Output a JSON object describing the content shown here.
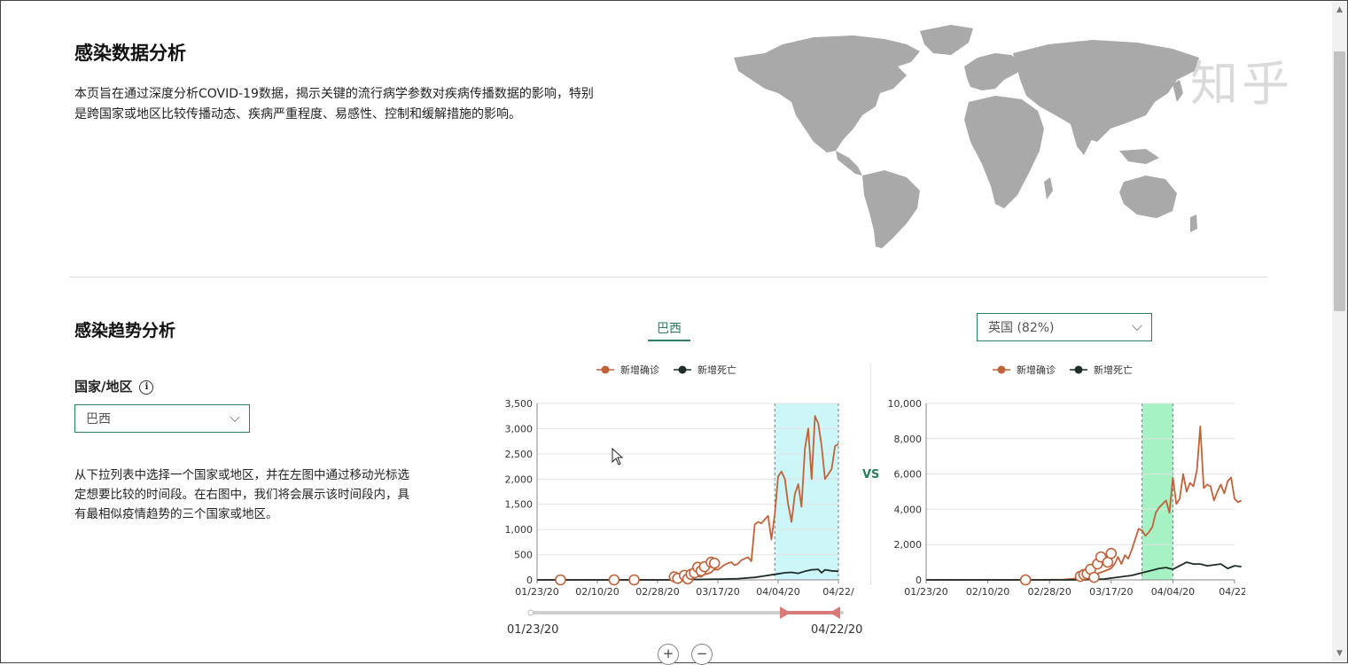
{
  "section1": {
    "title": "感染数据分析",
    "description_line1": "本页旨在通过深度分析COVID-19数据，揭示关键的流行病学参数对疾病传播数据的影响，特别",
    "description_line2": "是跨国家或地区比较传播动态、疾病严重程度、易感性、控制和缓解措施的影响。"
  },
  "watermark": "知乎",
  "section2": {
    "title": "感染趋势分析",
    "country_label": "国家/地区",
    "info_icon_glyph": "i",
    "country_select_value": "巴西",
    "help_line1": "从下拉列表中选择一个国家或地区，并在左图中通过移动光标选",
    "help_line2": "定想要比较的时间段。在右图中，我们将会展示该时间段内，具",
    "help_line3": "有最相似疫情趋势的三个国家或地区。"
  },
  "left_tab": "巴西",
  "right_select_value": "英国 (82%)",
  "vs_label": "VS",
  "legend": {
    "confirmed": "新增确诊",
    "deaths": "新增死亡"
  },
  "slider": {
    "start_label": "01/23/20",
    "end_label": "04/22/20"
  },
  "zoom": {
    "in": "+",
    "out": "−"
  },
  "colors": {
    "confirmed": "#c0623a",
    "deaths": "#1f2d2a",
    "accent": "#2e7d62",
    "highlight_left": "#cdf6f8",
    "highlight_right": "#a6f2c4",
    "slider_range": "#d97b78"
  },
  "chart_data": [
    {
      "type": "line",
      "country": "巴西",
      "x_ticks": [
        "01/23/20",
        "02/10/20",
        "02/28/20",
        "03/17/20",
        "04/04/20",
        "04/22/"
      ],
      "y_ticks": [
        "0",
        "500",
        "1,000",
        "1,500",
        "2,000",
        "2,500",
        "3,000",
        "3,500"
      ],
      "ylim": [
        0,
        3500
      ],
      "xlim_days": [
        0,
        90
      ],
      "highlight_days": [
        71,
        90
      ],
      "series": [
        {
          "name": "新增确诊",
          "points": [
            [
              0,
              0
            ],
            [
              10,
              0
            ],
            [
              20,
              0
            ],
            [
              30,
              0
            ],
            [
              38,
              0
            ],
            [
              40,
              0
            ],
            [
              43,
              10
            ],
            [
              45,
              40
            ],
            [
              47,
              90
            ],
            [
              49,
              60
            ],
            [
              50,
              110
            ],
            [
              51,
              120
            ],
            [
              52,
              150
            ],
            [
              53,
              210
            ],
            [
              54,
              200
            ],
            [
              55,
              250
            ],
            [
              56,
              300
            ],
            [
              57,
              330
            ],
            [
              58,
              350
            ],
            [
              59,
              290
            ],
            [
              60,
              320
            ],
            [
              61,
              390
            ],
            [
              62,
              420
            ],
            [
              63,
              450
            ],
            [
              64,
              370
            ],
            [
              65,
              1100
            ],
            [
              66,
              1150
            ],
            [
              67,
              1120
            ],
            [
              68,
              1200
            ],
            [
              69,
              1270
            ],
            [
              70,
              800
            ],
            [
              71,
              1300
            ],
            [
              72,
              2050
            ],
            [
              73,
              2150
            ],
            [
              74,
              2000
            ],
            [
              75,
              1500
            ],
            [
              76,
              1150
            ],
            [
              77,
              1700
            ],
            [
              78,
              1900
            ],
            [
              79,
              1450
            ],
            [
              80,
              2600
            ],
            [
              81,
              3000
            ],
            [
              82,
              2000
            ],
            [
              83,
              3250
            ],
            [
              84,
              3100
            ],
            [
              85,
              2650
            ],
            [
              86,
              2000
            ],
            [
              87,
              2100
            ],
            [
              88,
              2200
            ],
            [
              89,
              2650
            ],
            [
              90,
              2700
            ]
          ],
          "markers": [
            [
              7,
              0
            ],
            [
              23,
              0
            ],
            [
              29,
              0
            ],
            [
              41,
              60
            ],
            [
              42,
              30
            ],
            [
              44,
              90
            ],
            [
              45,
              20
            ],
            [
              46,
              110
            ],
            [
              47,
              140
            ],
            [
              48,
              250
            ],
            [
              49,
              180
            ],
            [
              50,
              260
            ],
            [
              52,
              350
            ],
            [
              53,
              330
            ]
          ]
        },
        {
          "name": "新增死亡",
          "points": [
            [
              0,
              0
            ],
            [
              40,
              0
            ],
            [
              50,
              10
            ],
            [
              55,
              15
            ],
            [
              60,
              25
            ],
            [
              65,
              50
            ],
            [
              68,
              80
            ],
            [
              70,
              100
            ],
            [
              72,
              120
            ],
            [
              74,
              140
            ],
            [
              76,
              150
            ],
            [
              78,
              130
            ],
            [
              80,
              170
            ],
            [
              82,
              200
            ],
            [
              84,
              210
            ],
            [
              85,
              140
            ],
            [
              86,
              200
            ],
            [
              88,
              180
            ],
            [
              90,
              170
            ]
          ]
        }
      ]
    },
    {
      "type": "line",
      "country": "英国 (82%)",
      "x_ticks": [
        "01/23/20",
        "02/10/20",
        "02/28/20",
        "03/17/20",
        "04/04/20",
        "04/22/"
      ],
      "y_ticks": [
        "0",
        "2,000",
        "4,000",
        "6,000",
        "8,000",
        "10,000"
      ],
      "ylim": [
        0,
        10000
      ],
      "xlim_days": [
        0,
        90
      ],
      "highlight_days": [
        63,
        72
      ],
      "series": [
        {
          "name": "新增确诊",
          "points": [
            [
              0,
              0
            ],
            [
              30,
              0
            ],
            [
              40,
              20
            ],
            [
              45,
              100
            ],
            [
              48,
              200
            ],
            [
              50,
              350
            ],
            [
              52,
              500
            ],
            [
              54,
              650
            ],
            [
              55,
              900
            ],
            [
              56,
              1300
            ],
            [
              57,
              900
            ],
            [
              58,
              1400
            ],
            [
              59,
              1200
            ],
            [
              60,
              1700
            ],
            [
              61,
              2300
            ],
            [
              62,
              2900
            ],
            [
              63,
              2800
            ],
            [
              64,
              2500
            ],
            [
              65,
              2700
            ],
            [
              66,
              3000
            ],
            [
              67,
              3800
            ],
            [
              68,
              4100
            ],
            [
              69,
              4300
            ],
            [
              70,
              4500
            ],
            [
              71,
              3800
            ],
            [
              72,
              5800
            ],
            [
              73,
              4300
            ],
            [
              74,
              4600
            ],
            [
              75,
              6000
            ],
            [
              76,
              5000
            ],
            [
              77,
              5500
            ],
            [
              78,
              5300
            ],
            [
              79,
              6200
            ],
            [
              80,
              8700
            ],
            [
              81,
              5200
            ],
            [
              82,
              5400
            ],
            [
              83,
              5300
            ],
            [
              84,
              4500
            ],
            [
              85,
              5000
            ],
            [
              86,
              5400
            ],
            [
              87,
              4900
            ],
            [
              88,
              5600
            ],
            [
              89,
              5800
            ],
            [
              90,
              4600
            ],
            [
              91,
              4400
            ],
            [
              92,
              4500
            ]
          ],
          "markers": [
            [
              29,
              0
            ],
            [
              45,
              200
            ],
            [
              46,
              300
            ],
            [
              47,
              350
            ],
            [
              48,
              600
            ],
            [
              49,
              150
            ],
            [
              50,
              900
            ],
            [
              51,
              1300
            ],
            [
              53,
              1000
            ],
            [
              54,
              1500
            ]
          ]
        },
        {
          "name": "新增死亡",
          "points": [
            [
              0,
              0
            ],
            [
              45,
              0
            ],
            [
              52,
              50
            ],
            [
              56,
              150
            ],
            [
              60,
              250
            ],
            [
              63,
              400
            ],
            [
              66,
              550
            ],
            [
              68,
              650
            ],
            [
              70,
              700
            ],
            [
              72,
              600
            ],
            [
              74,
              800
            ],
            [
              76,
              1000
            ],
            [
              78,
              900
            ],
            [
              80,
              900
            ],
            [
              82,
              800
            ],
            [
              84,
              850
            ],
            [
              86,
              900
            ],
            [
              88,
              650
            ],
            [
              90,
              800
            ],
            [
              92,
              750
            ]
          ]
        }
      ]
    }
  ]
}
